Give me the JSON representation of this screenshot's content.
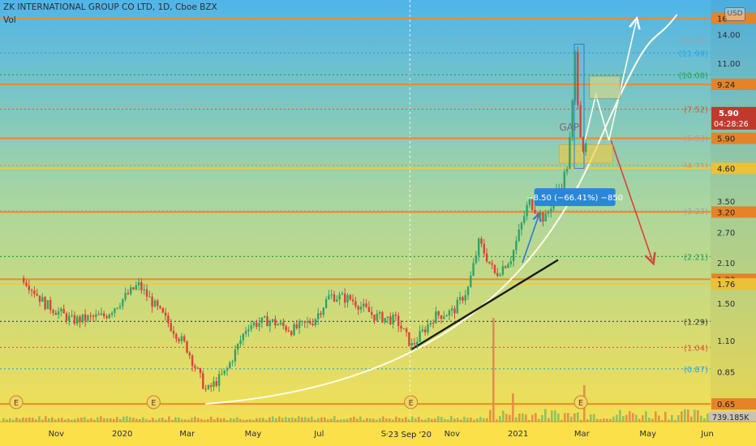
{
  "header": {
    "title": "ZK INTERNATIONAL GROUP CO LTD, 1D, Cboe BZX",
    "volume_label": "Vol",
    "currency": "USD"
  },
  "chart_data": {
    "type": "line",
    "title": "ZK INTERNATIONAL GROUP CO LTD, 1D, Cboe BZX",
    "scale": "log",
    "ylim": [
      0.58,
      18
    ],
    "y_ticks": [
      14.0,
      11.0,
      3.5,
      2.7,
      2.1,
      1.5,
      1.1,
      0.85
    ],
    "x_ticks": [
      "Nov",
      "2020",
      "Mar",
      "May",
      "Jul",
      "Se",
      "Nov",
      "2021",
      "Mar",
      "May",
      "Jun"
    ],
    "x_marker": "23 Sep '20",
    "price_series": {
      "x": [
        "2019-10-01",
        "2019-10-20",
        "2019-11-15",
        "2019-12-15",
        "2020-01-15",
        "2020-02-10",
        "2020-02-28",
        "2020-03-18",
        "2020-04-05",
        "2020-04-25",
        "2020-05-15",
        "2020-06-05",
        "2020-06-25",
        "2020-07-10",
        "2020-07-30",
        "2020-08-20",
        "2020-09-10",
        "2020-09-24",
        "2020-10-15",
        "2020-11-01",
        "2020-11-15",
        "2020-11-25",
        "2020-12-10",
        "2020-12-25",
        "2021-01-10",
        "2021-01-25",
        "2021-02-05",
        "2021-02-12",
        "2021-02-18",
        "2021-02-22",
        "2021-02-26",
        "2021-03-03",
        "2021-03-06"
      ],
      "values": [
        1.85,
        1.5,
        1.3,
        1.35,
        1.75,
        1.3,
        1.05,
        0.72,
        0.85,
        1.25,
        1.3,
        1.2,
        1.3,
        1.6,
        1.55,
        1.35,
        1.3,
        1.05,
        1.35,
        1.4,
        1.7,
        2.5,
        1.9,
        2.2,
        3.5,
        3.0,
        3.8,
        4.2,
        6.0,
        11.8,
        7.0,
        5.0,
        5.5
      ]
    },
    "horizontal_levels": [
      {
        "value": 16.0,
        "label": "16",
        "style": "solid",
        "color": "#f0882a"
      },
      {
        "value": 13.38,
        "label": "(13.38)",
        "style": "dotted",
        "color": "#9aa2ad"
      },
      {
        "value": 11.99,
        "label": "(11.99)",
        "style": "dotted",
        "color": "#2aa3e0"
      },
      {
        "value": 10.0,
        "label": "(10.00)",
        "style": "dotted",
        "color": "#22a34a"
      },
      {
        "value": 9.24,
        "label": "9.24",
        "style": "solid",
        "color": "#f0882a"
      },
      {
        "value": 7.52,
        "label": "(7.52)",
        "style": "dotted",
        "color": "#e0523a"
      },
      {
        "value": 5.93,
        "label": "(5.93)",
        "style": "dotted",
        "color": "#9aa2ad"
      },
      {
        "value": 5.9,
        "label": "5.90",
        "style": "solid",
        "color": "#f0882a"
      },
      {
        "value": 4.71,
        "label": "(4.71)",
        "style": "dotted",
        "color": "#f0882a"
      },
      {
        "value": 4.6,
        "label": "4.60",
        "style": "solid",
        "color": "#f5c93a"
      },
      {
        "value": 3.23,
        "label": "(3.23)",
        "style": "dotted",
        "color": "#9aa2ad"
      },
      {
        "value": 3.2,
        "label": "3.20",
        "style": "solid",
        "color": "#f0882a"
      },
      {
        "value": 2.21,
        "label": "(2.21)",
        "style": "dotted",
        "color": "#22a34a"
      },
      {
        "value": 1.83,
        "label": "1.83",
        "style": "solid",
        "color": "#f0882a"
      },
      {
        "value": 1.76,
        "label": "1.76",
        "style": "solid",
        "color": "#f5c93a"
      },
      {
        "value": 1.29,
        "label": "(1.29)",
        "style": "dotted",
        "color": "#3a3f4a"
      },
      {
        "value": 1.04,
        "label": "(1.04)",
        "style": "dotted",
        "color": "#e0523a"
      },
      {
        "value": 0.87,
        "label": "(0.87)",
        "style": "dotted",
        "color": "#2aa3e0"
      },
      {
        "value": 0.65,
        "label": "0.65",
        "style": "solid",
        "color": "#f0882a"
      }
    ],
    "current_price": {
      "label": "5.90",
      "countdown": "04:28:26",
      "color": "#c0392b"
    },
    "volume_readout": "739.185K",
    "annotations": {
      "gap_label": "GAP",
      "measure_label": "−8.50 (−66.41%) −850"
    },
    "earnings_markers": [
      "E",
      "E",
      "E",
      "E"
    ]
  },
  "colors": {
    "gradient_top": "#4fb5e8",
    "gradient_mid": "#a9d6a0",
    "gradient_bottom": "#fce04a",
    "candle_up": "#2ea36b",
    "candle_down": "#d8433b",
    "level_orange": "#f0882a"
  }
}
